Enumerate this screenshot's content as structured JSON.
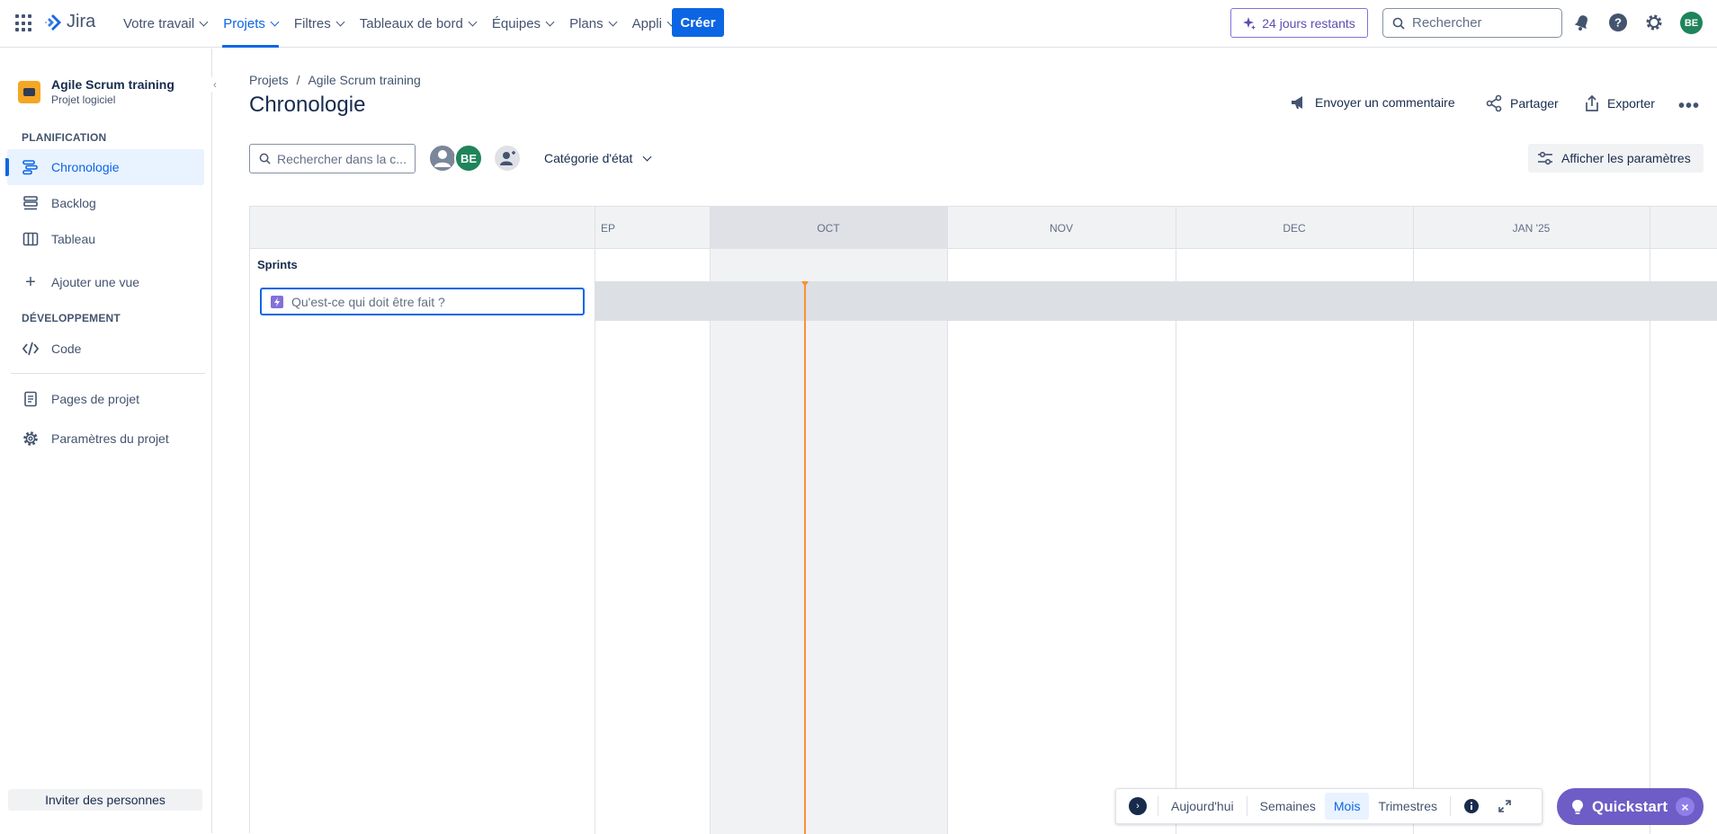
{
  "topnav": {
    "logo": "Jira",
    "items": [
      {
        "label": "Votre travail",
        "active": false
      },
      {
        "label": "Projets",
        "active": true
      },
      {
        "label": "Filtres",
        "active": false
      },
      {
        "label": "Tableaux de bord",
        "active": false
      },
      {
        "label": "Équipes",
        "active": false
      },
      {
        "label": "Plans",
        "active": false
      },
      {
        "label": "Appli",
        "active": false
      }
    ],
    "create_label": "Créer",
    "trial_label": "24 jours restants",
    "search_placeholder": "Rechercher",
    "avatar_initials": "BE"
  },
  "sidebar": {
    "project_name": "Agile Scrum training",
    "project_type": "Projet logiciel",
    "planning_label": "PLANIFICATION",
    "planning_items": [
      {
        "label": "Chronologie",
        "icon": "timeline-icon",
        "active": true
      },
      {
        "label": "Backlog",
        "icon": "backlog-icon",
        "active": false
      },
      {
        "label": "Tableau",
        "icon": "board-icon",
        "active": false
      }
    ],
    "add_view_label": "Ajouter une vue",
    "dev_label": "DÉVELOPPEMENT",
    "code_label": "Code",
    "pages_label": "Pages de projet",
    "settings_label": "Paramètres du projet",
    "invite_label": "Inviter des personnes"
  },
  "main": {
    "breadcrumb": [
      "Projets",
      "/",
      "Agile Scrum training"
    ],
    "title": "Chronologie",
    "actions": {
      "feedback": "Envoyer un commentaire",
      "share": "Partager",
      "export": "Exporter"
    },
    "timeline_search_placeholder": "Rechercher dans la c...",
    "avatar_initials": "BE",
    "status_category": "Catégorie d'état",
    "view_settings": "Afficher les paramètres"
  },
  "timeline": {
    "months": [
      "EP",
      "OCT",
      "NOV",
      "DEC",
      "JAN '25"
    ],
    "sprints_label": "Sprints",
    "new_issue_placeholder": "Qu'est-ce qui doit être fait ?"
  },
  "controls": {
    "today": "Aujourd'hui",
    "weeks": "Semaines",
    "months": "Mois",
    "quarters": "Trimestres",
    "active": "Mois"
  },
  "quickstart": {
    "label": "Quickstart"
  },
  "colors": {
    "brand": "#0c66e4",
    "today": "#f79233",
    "quickstart": "#6e5dc6",
    "avatar": "#1f845a"
  }
}
